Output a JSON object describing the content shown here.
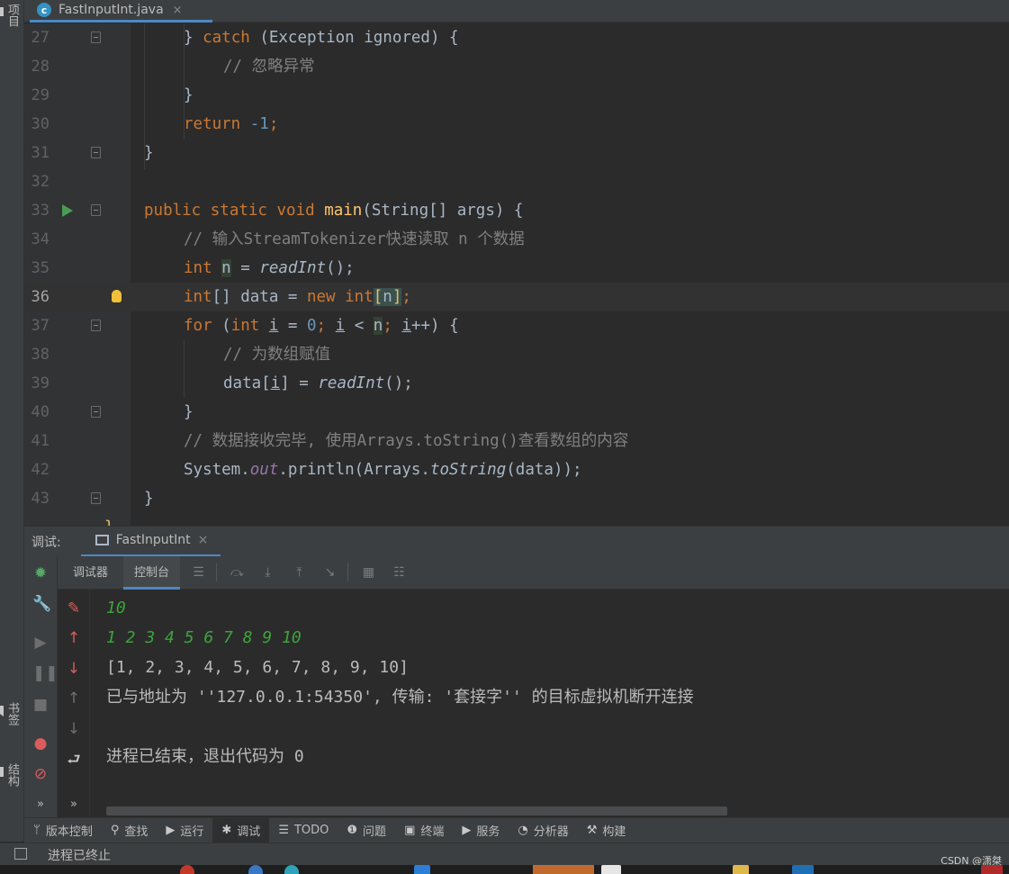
{
  "left_strip": {
    "project": "项目",
    "bookmarks": "书签",
    "structure": "结构"
  },
  "tabs": [
    {
      "label": "FastInputInt.java",
      "icon": "c",
      "close": "×"
    }
  ],
  "editor": {
    "lines": [
      {
        "no": "27"
      },
      {
        "no": "28"
      },
      {
        "no": "29"
      },
      {
        "no": "30"
      },
      {
        "no": "31"
      },
      {
        "no": "32"
      },
      {
        "no": "33"
      },
      {
        "no": "34"
      },
      {
        "no": "35"
      },
      {
        "no": "36"
      },
      {
        "no": "37"
      },
      {
        "no": "38"
      },
      {
        "no": "39"
      },
      {
        "no": "40"
      },
      {
        "no": "41"
      },
      {
        "no": "42"
      },
      {
        "no": "43"
      }
    ],
    "code": {
      "l27_close": "}",
      "l27_catch": "catch",
      "l27_args": " (Exception ignored) {",
      "l28": "// 忽略异常",
      "l29": "}",
      "l30_ret": "return",
      "l30_val": "-1",
      "l30_semi": ";",
      "l31": "}",
      "l33_mods": "public static void",
      "l33_fn": "main",
      "l33_rest": "(String[] args) {",
      "l34": "// 输入StreamTokenizer快速读取 n 个数据",
      "l35_type": "int",
      "l35_var": "n",
      "l35_eq": " = ",
      "l35_call": "readInt",
      "l35_end": "();",
      "l36_type": "int",
      "l36_arr": "[] data = ",
      "l36_new": "new",
      "l36_int": "int",
      "l36_lb": "[",
      "l36_n": "n",
      "l36_rb": "]",
      "l36_semi": ";",
      "l37_for": "for",
      "l37_p": " (",
      "l37_int": "int",
      "l37_i": "i",
      "l37_eq": " = ",
      "l37_zero": "0",
      "l37_semi1": "; ",
      "l37_i2": "i",
      "l37_lt": " < ",
      "l37_n": "n",
      "l37_semi2": "; ",
      "l37_i3": "i",
      "l37_inc": "++) {",
      "l38": "// 为数组赋值",
      "l39_data": "data[",
      "l39_i": "i",
      "l39_mid": "] = ",
      "l39_call": "readInt",
      "l39_end": "();",
      "l40": "}",
      "l41": "// 数据接收完毕, 使用Arrays.toString()查看数组的内容",
      "l42_sys": "System.",
      "l42_out": "out",
      "l42_print": ".println(Arrays.",
      "l42_ts": "toString",
      "l42_end": "(data));",
      "l43": "}",
      "l44": "}"
    }
  },
  "debug": {
    "label": "调试:",
    "run_config": "FastInputInt",
    "close": "×",
    "tabs": [
      "调试器",
      "控制台"
    ],
    "console_lines": [
      {
        "text": "10",
        "kind": "input"
      },
      {
        "text": "1 2 3 4 5 6 7 8 9 10",
        "kind": "input"
      },
      {
        "text": "[1, 2, 3, 4, 5, 6, 7, 8, 9, 10]",
        "kind": "output"
      },
      {
        "text": "已与地址为 ''127.0.0.1:54350', 传输: '套接字'' 的目标虚拟机断开连接",
        "kind": "output"
      },
      {
        "text": "",
        "kind": "output"
      },
      {
        "text": "进程已结束，退出代码为 0",
        "kind": "output"
      }
    ],
    "more": "»"
  },
  "tool_windows": [
    {
      "label": "版本控制",
      "icon": "branch-icon",
      "glyph": "ᛘ"
    },
    {
      "label": "查找",
      "icon": "search-icon",
      "glyph": "⚲"
    },
    {
      "label": "运行",
      "icon": "play-icon",
      "glyph": "▶"
    },
    {
      "label": "调试",
      "icon": "bug-icon",
      "glyph": "✱"
    },
    {
      "label": "TODO",
      "icon": "list-icon",
      "glyph": "☰"
    },
    {
      "label": "问题",
      "icon": "info-icon",
      "glyph": "❶"
    },
    {
      "label": "终端",
      "icon": "terminal-icon",
      "glyph": "▣"
    },
    {
      "label": "服务",
      "icon": "services-icon",
      "glyph": "▶"
    },
    {
      "label": "分析器",
      "icon": "profiler-icon",
      "glyph": "◔"
    },
    {
      "label": "构建",
      "icon": "hammer-icon",
      "glyph": "⚒"
    }
  ],
  "status": {
    "message": "进程已终止"
  },
  "watermark": "CSDN @潇桀"
}
